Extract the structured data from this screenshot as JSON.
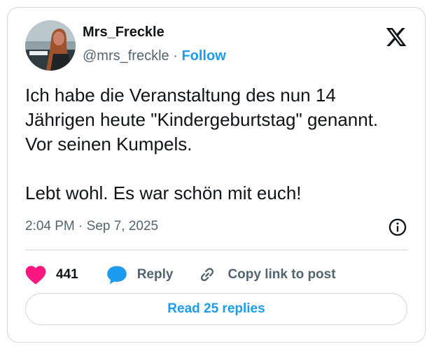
{
  "author": {
    "name": "Mrs_Freckle",
    "handle": "@mrs_freckle",
    "separator": " · ",
    "follow_label": "Follow"
  },
  "tweet": {
    "paragraphs": [
      "Ich habe die Veranstaltung des nun 14 Jährigen heute \"Kindergeburtstag\" genannt. Vor seinen Kumpels.",
      "Lebt wohl. Es war schön mit euch!"
    ],
    "timestamp": "2:04 PM · Sep 7, 2025"
  },
  "actions": {
    "like_count": "441",
    "reply_label": "Reply",
    "copy_label": "Copy link to post"
  },
  "read_replies_label": "Read 25 replies",
  "icons": {
    "logo": "x-logo-icon",
    "info": "info-icon",
    "like": "heart-icon",
    "reply": "speech-bubble-icon",
    "copy": "link-icon"
  },
  "colors": {
    "accent": "#1d9bf0",
    "like": "#f91880",
    "text": "#0f1419",
    "secondary": "#536471",
    "border": "#cfd9de"
  }
}
